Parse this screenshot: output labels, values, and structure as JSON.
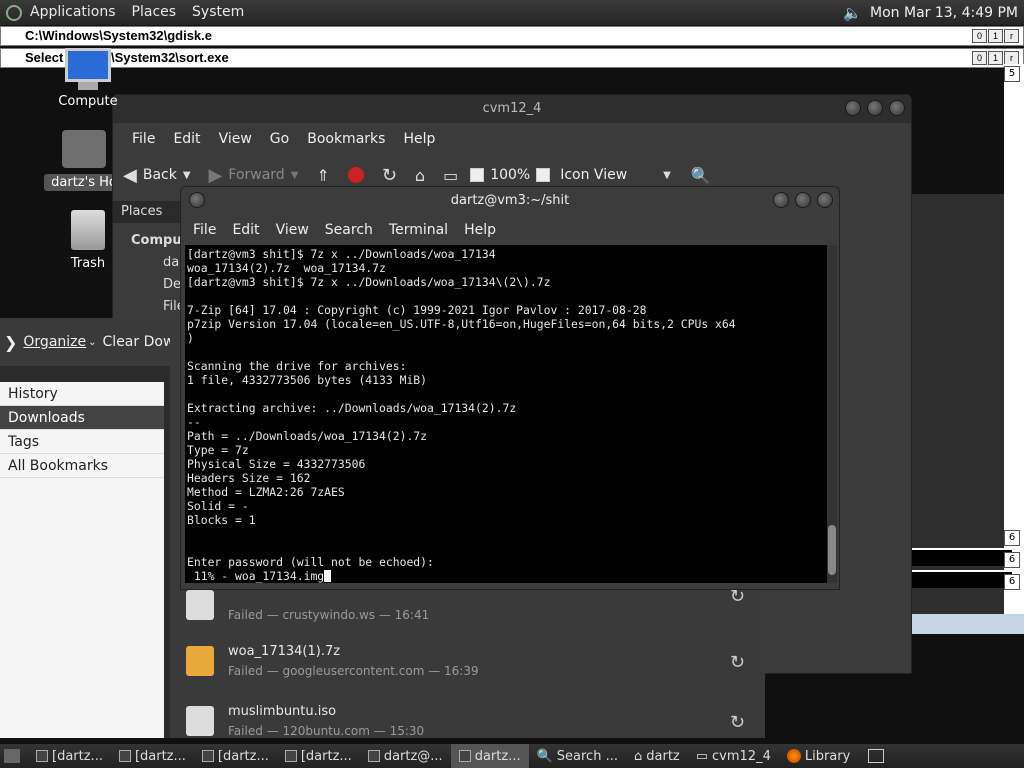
{
  "top_panel": {
    "menus": [
      "Applications",
      "Places",
      "System"
    ],
    "datetime": "Mon Mar 13,  4:49 PM"
  },
  "win_dialogs": [
    {
      "title": "C:\\Windows\\System32\\gdisk.e"
    },
    {
      "title": "Select ...dows\\System32\\sort.exe"
    }
  ],
  "desktop": {
    "icons": [
      "Compute",
      "dartz's Ho",
      "Trash"
    ]
  },
  "nautilus": {
    "title": "cvm12_4",
    "menus": [
      "File",
      "Edit",
      "View",
      "Go",
      "Bookmarks",
      "Help"
    ],
    "toolbar": {
      "back": "Back",
      "forward": "Forward",
      "zoom": "100%",
      "view": "Icon View"
    },
    "sidebar_header": "Places",
    "sidebar_items": [
      "Compute",
      "dar",
      "Des",
      "File"
    ]
  },
  "library": {
    "organize": "Organize",
    "clear": "Clear Downloads",
    "sidebar": [
      "History",
      "Downloads",
      "Tags",
      "All Bookmarks"
    ],
    "downloads": [
      {
        "name": "",
        "status": "Failed — crustywindo.ws — 16:41"
      },
      {
        "name": "woa_17134(1).7z",
        "status": "Failed — googleusercontent.com — 16:39"
      },
      {
        "name": "muslimbuntu.iso",
        "status": "Failed — 120buntu.com — 15:30"
      }
    ]
  },
  "terminal": {
    "title": "dartz@vm3:~/shit",
    "menus": [
      "File",
      "Edit",
      "View",
      "Search",
      "Terminal",
      "Help"
    ],
    "lines": [
      "[dartz@vm3 shit]$ 7z x ../Downloads/woa_17134",
      "woa_17134(2).7z  woa_17134.7z",
      "[dartz@vm3 shit]$ 7z x ../Downloads/woa_17134\\(2\\).7z",
      "",
      "7-Zip [64] 17.04 : Copyright (c) 1999-2021 Igor Pavlov : 2017-08-28",
      "p7zip Version 17.04 (locale=en_US.UTF-8,Utf16=on,HugeFiles=on,64 bits,2 CPUs x64",
      ")",
      "",
      "Scanning the drive for archives:",
      "1 file, 4332773506 bytes (4133 MiB)",
      "",
      "Extracting archive: ../Downloads/woa_17134(2).7z",
      "--",
      "Path = ../Downloads/woa_17134(2).7z",
      "Type = 7z",
      "Physical Size = 4332773506",
      "Headers Size = 162",
      "Method = LZMA2:26 7zAES",
      "Solid = -",
      "Blocks = 1",
      "",
      "",
      "Enter password (will not be echoed):",
      " 11% - woa_17134.img"
    ]
  },
  "right_fragments": [
    "ml",
    "st7",
    "nu",
    "un",
    "n:"
  ],
  "right_tabs": [
    "5",
    "6",
    "6",
    "6"
  ],
  "taskbar": [
    {
      "label": "[dartz..."
    },
    {
      "label": "[dartz..."
    },
    {
      "label": "[dartz..."
    },
    {
      "label": "[dartz..."
    },
    {
      "label": "dartz@..."
    },
    {
      "label": "dartz..."
    },
    {
      "label": "Search ..."
    },
    {
      "label": "dartz"
    },
    {
      "label": "cvm12_4"
    },
    {
      "label": "Library"
    }
  ]
}
